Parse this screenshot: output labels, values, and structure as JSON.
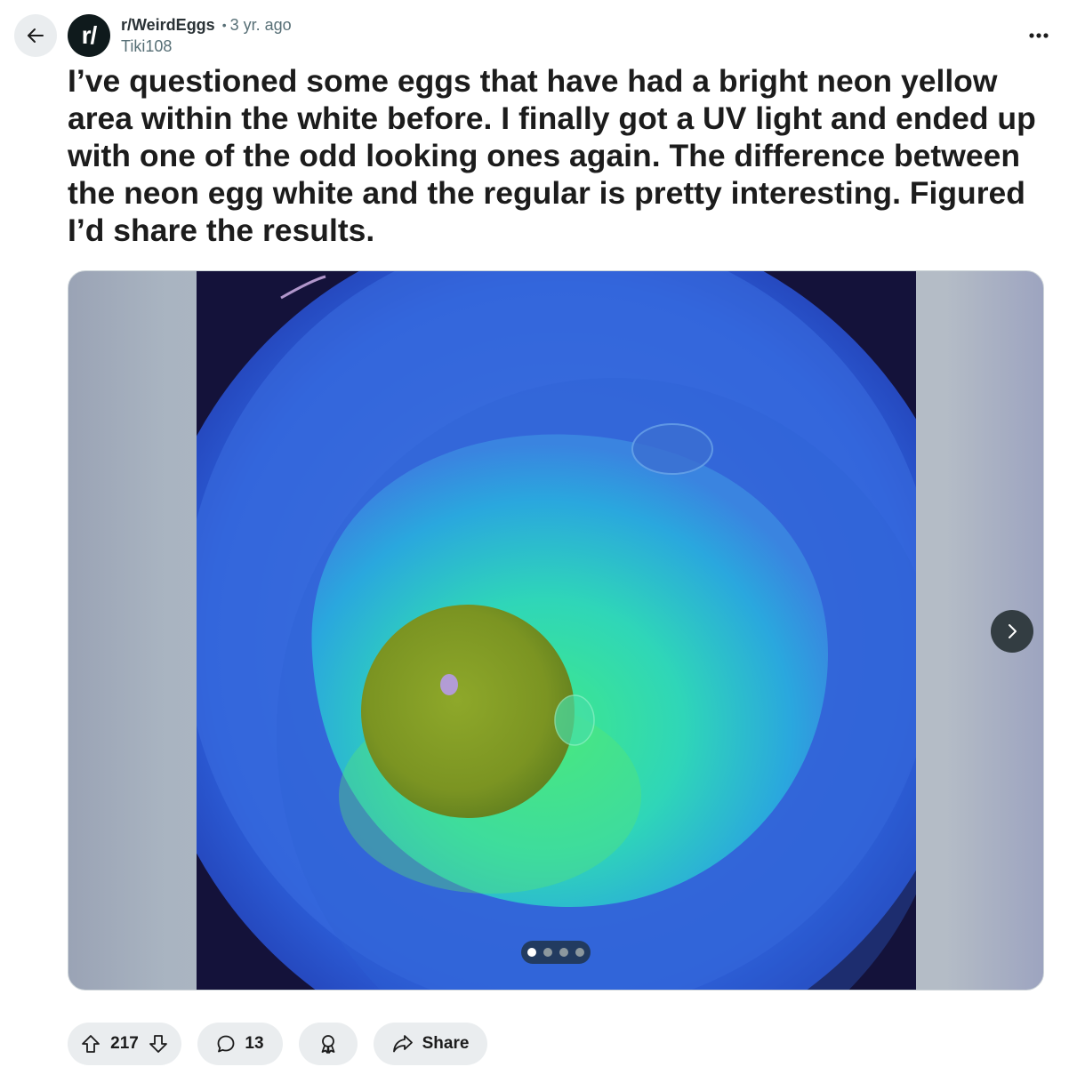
{
  "header": {
    "back_icon": "arrow-left-icon",
    "avatar_text": "r/",
    "subreddit": "r/WeirdEggs",
    "separator": "•",
    "time_ago": "3 yr. ago",
    "author": "Tiki108",
    "more_icon": "overflow-horizontal-icon"
  },
  "post": {
    "title": "I’ve questioned some eggs that have had a bright neon yellow area within the white before. I finally got a UV light and ended up with one of the odd looking ones again. The difference between the neon egg white and the regular is pretty interesting. Figured I’d share the results."
  },
  "gallery": {
    "image_count": 4,
    "current_index": 1,
    "next_icon": "chevron-right-icon"
  },
  "actions": {
    "upvote_icon": "upvote-arrow-icon",
    "vote_count": "217",
    "downvote_icon": "downvote-arrow-icon",
    "comment_icon": "speech-bubble-icon",
    "comment_count": "13",
    "award_icon": "award-ribbon-icon",
    "share_icon": "share-arrow-icon",
    "share_label": "Share"
  },
  "colors": {
    "pill_bg": "#eaedef",
    "text": "#1c1c1c",
    "muted": "#576f76"
  }
}
